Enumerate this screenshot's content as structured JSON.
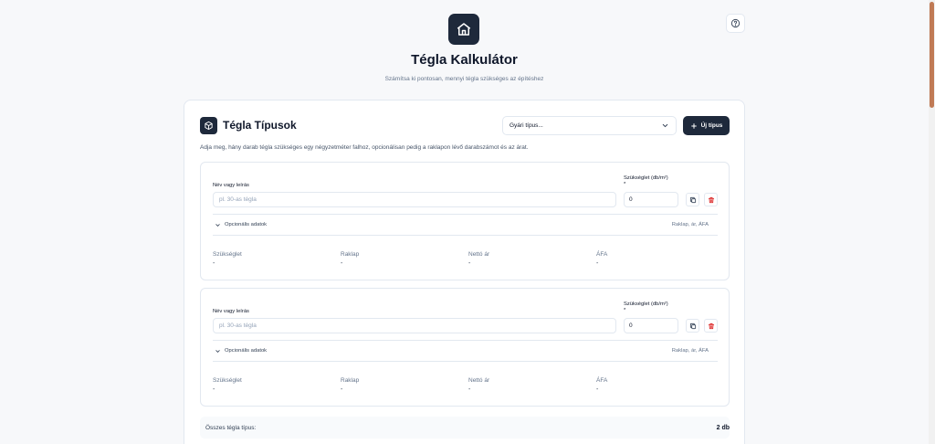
{
  "app": {
    "title": "Tégla Kalkulátor",
    "subtitle": "Számítsa ki pontosan, mennyi tégla szükséges az építéshez"
  },
  "section": {
    "title": "Tégla Típusok",
    "description": "Adja meg, hány darab tégla szükséges egy négyzetméter falhoz, opcionálisan pedig a raklapon lévő darabszámot és az árat.",
    "select_label": "Gyári típus...",
    "new_button": "Új típus"
  },
  "rows": [
    {
      "name_label": "Név vagy leírás",
      "name_placeholder": "pl. 30-as tégla",
      "req_label": "Szükséglet (db/m²)",
      "req_star": "*",
      "req_value": "0",
      "optional_label": "Opcionális adatok",
      "optional_hint": "Raklap, ár, ÁFA",
      "stats": [
        {
          "key": "Szükséglet",
          "value": "-"
        },
        {
          "key": "Raklap",
          "value": "-"
        },
        {
          "key": "Nettó ár",
          "value": "-"
        },
        {
          "key": "ÁFA",
          "value": "-"
        }
      ]
    },
    {
      "name_label": "Név vagy leírás",
      "name_placeholder": "pl. 30-as tégla",
      "req_label": "Szükséglet (db/m²)",
      "req_star": "*",
      "req_value": "0",
      "optional_label": "Opcionális adatok",
      "optional_hint": "Raklap, ár, ÁFA",
      "stats": [
        {
          "key": "Szükséglet",
          "value": "-"
        },
        {
          "key": "Raklap",
          "value": "-"
        },
        {
          "key": "Nettó ár",
          "value": "-"
        },
        {
          "key": "ÁFA",
          "value": "-"
        }
      ]
    }
  ],
  "summary": {
    "label": "Összes tégla típus:",
    "count": "2 db"
  },
  "colors": {
    "accent": "#1e293b",
    "danger": "#dc2626",
    "border": "#e2e8f0",
    "scroll_thumb": "#c07a55"
  },
  "icons": [
    "help-icon",
    "home-icon",
    "box-icon",
    "chevron-down-icon",
    "plus-icon",
    "copy-icon",
    "trash-icon"
  ]
}
